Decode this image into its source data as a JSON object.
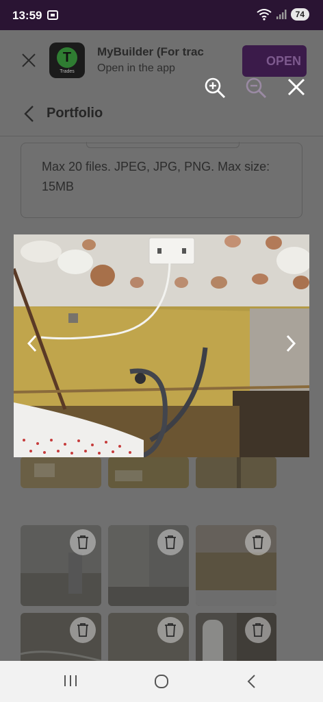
{
  "status": {
    "time": "13:59",
    "battery": "74"
  },
  "banner": {
    "title": "MyBuilder (For trac",
    "subtitle": "Open in the app",
    "open_label": "OPEN",
    "logo_letter": "T",
    "logo_caption": "Trades"
  },
  "nav": {
    "title": "Portfolio"
  },
  "upload": {
    "info": "Max 20 files. JPEG, JPG, PNG. Max size: 15MB"
  },
  "viewer": {
    "zoom_in_icon": "zoom-in-icon",
    "zoom_out_icon": "zoom-out-icon",
    "close_icon": "close-icon",
    "prev_icon": "chevron-left-icon",
    "next_icon": "chevron-right-icon"
  },
  "thumbnails": {
    "delete_icon": "trash-icon",
    "count_visible": 9
  },
  "colors": {
    "status_bar": "#2a1433",
    "open_button": "#3b1b4a",
    "overlay": "#707070"
  }
}
